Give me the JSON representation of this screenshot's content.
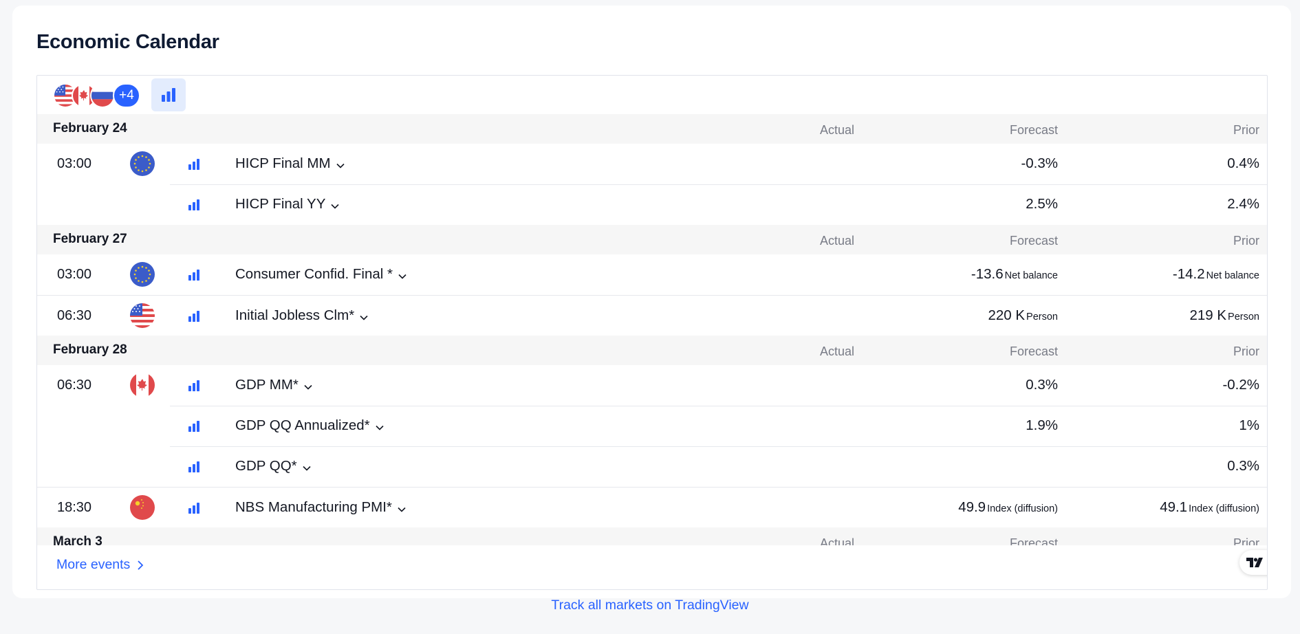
{
  "title": "Economic Calendar",
  "toolbar": {
    "more_countries": "+4"
  },
  "columns": {
    "actual": "Actual",
    "forecast": "Forecast",
    "prior": "Prior"
  },
  "groups": [
    {
      "date": "February 24",
      "events": [
        {
          "time": "03:00",
          "country": "EU",
          "name": "HICP Final MM",
          "actual": "",
          "forecast": "-0.3%",
          "forecast_unit": "",
          "prior": "0.4%",
          "prior_unit": ""
        },
        {
          "time": "",
          "country": "",
          "name": "HICP Final YY",
          "actual": "",
          "forecast": "2.5%",
          "forecast_unit": "",
          "prior": "2.4%",
          "prior_unit": ""
        }
      ]
    },
    {
      "date": "February 27",
      "events": [
        {
          "time": "03:00",
          "country": "EU",
          "name": "Consumer Confid. Final *",
          "actual": "",
          "forecast": "-13.6",
          "forecast_unit": "Net balance",
          "prior": "-14.2",
          "prior_unit": "Net balance"
        },
        {
          "time": "06:30",
          "country": "US",
          "name": "Initial Jobless Clm*",
          "actual": "",
          "forecast": "220 K",
          "forecast_unit": "Person",
          "prior": "219 K",
          "prior_unit": "Person"
        }
      ]
    },
    {
      "date": "February 28",
      "events": [
        {
          "time": "06:30",
          "country": "CA",
          "name": "GDP MM*",
          "actual": "",
          "forecast": "0.3%",
          "forecast_unit": "",
          "prior": "-0.2%",
          "prior_unit": ""
        },
        {
          "time": "",
          "country": "",
          "name": "GDP QQ Annualized*",
          "actual": "",
          "forecast": "1.9%",
          "forecast_unit": "",
          "prior": "1%",
          "prior_unit": ""
        },
        {
          "time": "",
          "country": "",
          "name": "GDP QQ*",
          "actual": "",
          "forecast": "",
          "forecast_unit": "",
          "prior": "0.3%",
          "prior_unit": ""
        },
        {
          "time": "18:30",
          "country": "CN",
          "name": "NBS Manufacturing PMI*",
          "actual": "",
          "forecast": "49.9",
          "forecast_unit": "Index (diffusion)",
          "prior": "49.1",
          "prior_unit": "Index (diffusion)"
        }
      ]
    },
    {
      "date": "March 3",
      "events": []
    }
  ],
  "more_events_label": "More events",
  "footer_link": "Track all markets on TradingView",
  "colors": {
    "accent": "#2962ff",
    "text": "#131722",
    "muted": "#787b86",
    "date_bg": "#f6f6f6"
  }
}
